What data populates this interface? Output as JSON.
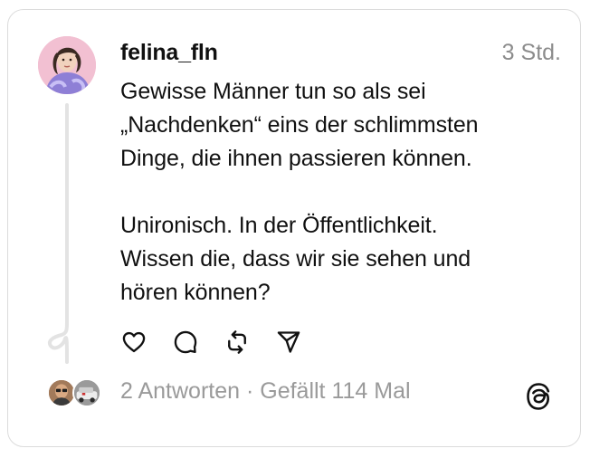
{
  "post": {
    "username": "felina_fln",
    "time": "3 Std.",
    "lines": [
      "Gewisse Männer tun so als sei",
      "„Nachdenken“ eins der schlimmsten",
      "Dinge, die ihnen passieren können.",
      "Unironisch. In der Öffentlichkeit.",
      "Wissen die, dass wir sie sehen und",
      "hören können?"
    ]
  },
  "actions": {
    "like_icon": "heart-icon",
    "comment_icon": "comment-icon",
    "repost_icon": "repost-icon",
    "share_icon": "send-icon"
  },
  "stats": {
    "replies": "2 Antworten",
    "separator": " · ",
    "likes": "Gefällt 114 Mal"
  },
  "colors": {
    "text": "#101010",
    "muted": "#8c8c8c",
    "border": "#dcdcdc"
  }
}
